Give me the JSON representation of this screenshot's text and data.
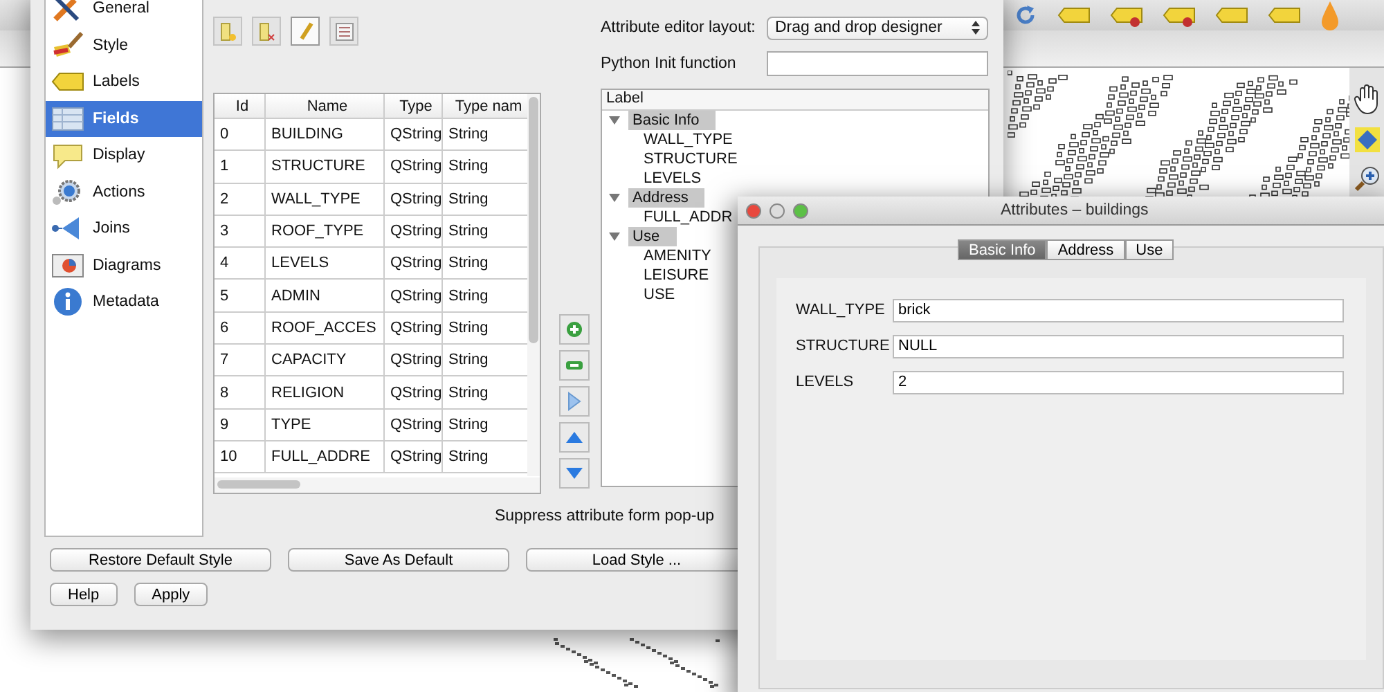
{
  "sidebar": {
    "items": [
      {
        "label": "General",
        "selected": false
      },
      {
        "label": "Style",
        "selected": false
      },
      {
        "label": "Labels",
        "selected": false
      },
      {
        "label": "Fields",
        "selected": true
      },
      {
        "label": "Display",
        "selected": false
      },
      {
        "label": "Actions",
        "selected": false
      },
      {
        "label": "Joins",
        "selected": false
      },
      {
        "label": "Diagrams",
        "selected": false
      },
      {
        "label": "Metadata",
        "selected": false
      }
    ]
  },
  "layout_form": {
    "layout_label": "Attribute editor layout:",
    "layout_value": "Drag and drop designer",
    "init_label": "Python Init function"
  },
  "fields_table": {
    "columns": [
      "Id",
      "Name",
      "Type",
      "Type nam"
    ],
    "rows": [
      {
        "id": "0",
        "name": "BUILDING",
        "type": "QString",
        "type_name": "String"
      },
      {
        "id": "1",
        "name": "STRUCTURE",
        "type": "QString",
        "type_name": "String"
      },
      {
        "id": "2",
        "name": "WALL_TYPE",
        "type": "QString",
        "type_name": "String"
      },
      {
        "id": "3",
        "name": "ROOF_TYPE",
        "type": "QString",
        "type_name": "String"
      },
      {
        "id": "4",
        "name": "LEVELS",
        "type": "QString",
        "type_name": "String"
      },
      {
        "id": "5",
        "name": "ADMIN",
        "type": "QString",
        "type_name": "String"
      },
      {
        "id": "6",
        "name": "ROOF_ACCES",
        "type": "QString",
        "type_name": "String"
      },
      {
        "id": "7",
        "name": "CAPACITY",
        "type": "QString",
        "type_name": "String"
      },
      {
        "id": "8",
        "name": "RELIGION",
        "type": "QString",
        "type_name": "String"
      },
      {
        "id": "9",
        "name": "TYPE",
        "type": "QString",
        "type_name": "String"
      },
      {
        "id": "10",
        "name": "FULL_ADDRE",
        "type": "QString",
        "type_name": "String"
      }
    ]
  },
  "tree": {
    "header": "Label",
    "groups": [
      {
        "label": "Basic Info",
        "expanded": true,
        "children": [
          {
            "label": "WALL_TYPE"
          },
          {
            "label": "STRUCTURE"
          },
          {
            "label": "LEVELS"
          }
        ]
      },
      {
        "label": "Address",
        "expanded": true,
        "children": [
          {
            "label": "FULL_ADDR"
          }
        ]
      },
      {
        "label": "Use",
        "expanded": true,
        "children": [
          {
            "label": "AMENITY"
          },
          {
            "label": "LEISURE"
          },
          {
            "label": "USE"
          }
        ]
      }
    ]
  },
  "suppress_label": "Suppress attribute form pop-up",
  "style_buttons": [
    "Restore Default Style",
    "Save As Default",
    "Load Style ..."
  ],
  "dialog_buttons": [
    "Help",
    "Apply"
  ],
  "attributes_dialog": {
    "title": "Attributes – buildings",
    "tabs": [
      {
        "label": "Basic Info",
        "selected": true
      },
      {
        "label": "Address",
        "selected": false
      },
      {
        "label": "Use",
        "selected": false
      }
    ],
    "fields": [
      {
        "label": "WALL_TYPE",
        "value": "brick"
      },
      {
        "label": "STRUCTURE",
        "value": "NULL"
      },
      {
        "label": "LEVELS",
        "value": "2"
      }
    ]
  }
}
